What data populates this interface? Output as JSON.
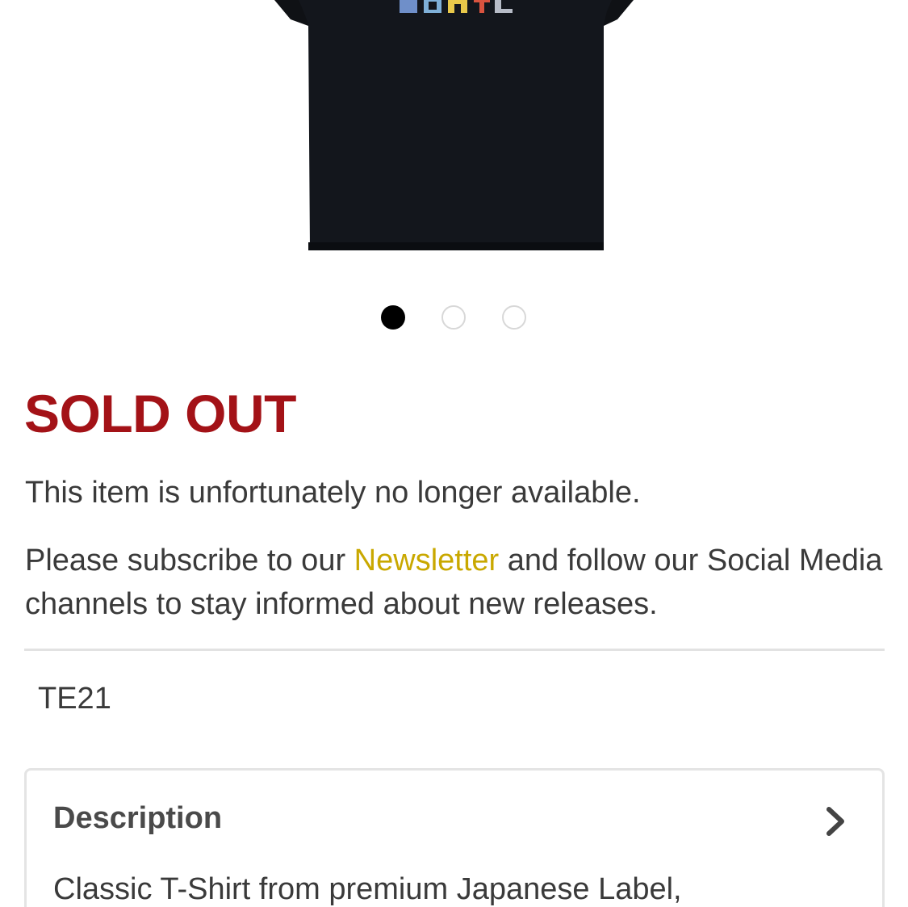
{
  "product": {
    "image": {
      "icon": "black-tshirt-product-image",
      "print_text": "FDMTL"
    },
    "carousel": {
      "total_slides": 3,
      "active_index": 0
    },
    "status": "SOLD OUT",
    "unavailable_text": "This item is unfortunately no longer available.",
    "subscribe_before": "Please subscribe to our ",
    "newsletter_link": "Newsletter",
    "subscribe_after": " and follow our Social Media channels to stay informed about new releases.",
    "sku": "TE21",
    "description": {
      "title": "Description",
      "text": "Classic T-Shirt from premium Japanese Label,"
    }
  },
  "colors": {
    "sold_out": "#a31217",
    "link": "#c9a800",
    "body_text": "#3a3a3a"
  }
}
